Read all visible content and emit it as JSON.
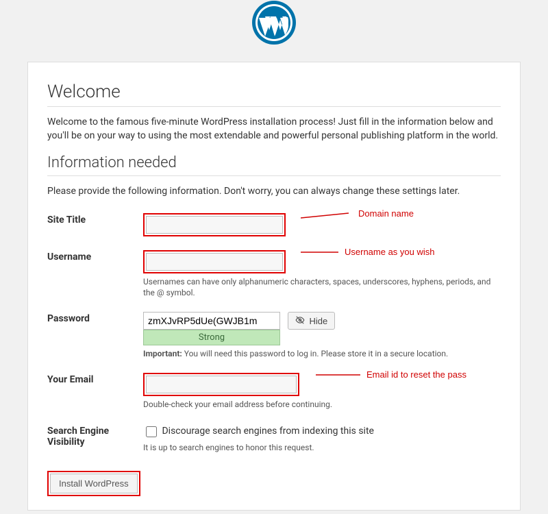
{
  "logo": {
    "name": "wordpress-logo-icon",
    "color": "#0073aa"
  },
  "headings": {
    "welcome": "Welcome",
    "info_needed": "Information needed"
  },
  "intro": "Welcome to the famous five-minute WordPress installation process! Just fill in the information below and you'll be on your way to using the most extendable and powerful personal publishing platform in the world.",
  "info_instruction": "Please provide the following information. Don't worry, you can always change these settings later.",
  "fields": {
    "site_title": {
      "label": "Site Title",
      "value": ""
    },
    "username": {
      "label": "Username",
      "value": "",
      "hint": "Usernames can have only alphanumeric characters, spaces, underscores, hyphens, periods, and the @ symbol."
    },
    "password": {
      "label": "Password",
      "value": "zmXJvRP5dUe(GWJB1m",
      "strength": "Strong",
      "hide_label": "Hide",
      "important_label": "Important:",
      "important_text": " You will need this password to log in. Please store it in a secure location."
    },
    "email": {
      "label": "Your Email",
      "value": "",
      "hint": "Double-check your email address before continuing."
    },
    "sev": {
      "label": "Search Engine Visibility",
      "checkbox_label": "Discourage search engines from indexing this site",
      "hint": "It is up to search engines to honor this request."
    }
  },
  "annotations": {
    "site_title": "Domain name",
    "username": "Username as you wish",
    "email": "Email id to reset the pass"
  },
  "submit": {
    "label": "Install WordPress"
  }
}
